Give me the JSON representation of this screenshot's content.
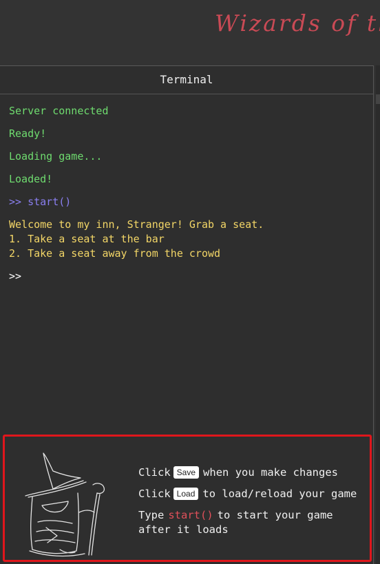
{
  "header": {
    "title": "Wizards of the"
  },
  "panel": {
    "tab_label": "Terminal"
  },
  "terminal": {
    "status_lines": [
      "Server connected",
      "Ready!",
      "Loading game...",
      "Loaded!"
    ],
    "command_line": ">> start()",
    "output_lines": [
      "Welcome to my inn, Stranger! Grab a seat.",
      "1. Take a seat at the bar",
      "2. Take a seat away from the crowd"
    ],
    "prompt": ">>"
  },
  "help": {
    "line1": {
      "prefix": "Click",
      "button": "Save",
      "suffix": "when you make changes"
    },
    "line2": {
      "prefix": "Click",
      "button": "Load",
      "suffix": "to load/reload your game"
    },
    "line3": {
      "prefix": "Type",
      "code": "start()",
      "suffix": "to start your game",
      "continuation": "after it loads"
    }
  },
  "colors": {
    "status": "#6fdc6f",
    "command": "#8a7ff0",
    "output": "#f3d667",
    "highlight_border": "#e0161c",
    "title": "#c94a55"
  },
  "icons": {
    "illustration": "wizard-sketch-icon"
  }
}
